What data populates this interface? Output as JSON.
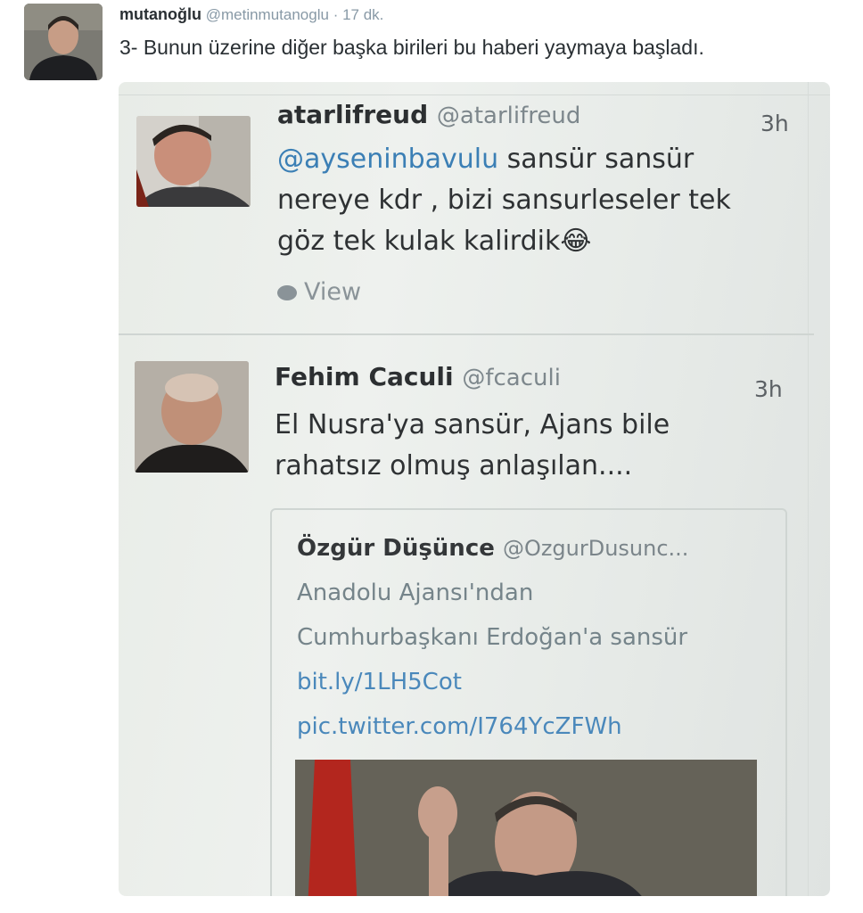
{
  "tweet": {
    "display_name": "mutanoğlu",
    "handle": "@metinmutanoglu",
    "separator": "·",
    "time": "17 dk.",
    "text": "3- Bunun üzerine diğer başka birileri bu haberi yaymaya başladı."
  },
  "photo": {
    "tweets": [
      {
        "name": "atarlifreud",
        "handle": "@atarlifreud",
        "time": "3h",
        "mention": "@ayseninbavulu",
        "line1_rest": " sansür sansür",
        "line2": "nereye kdr , bizi sansurleseler tek",
        "line3": "göz tek kulak kalirdik😂",
        "action_label": "View"
      },
      {
        "name": "Fehim Caculi",
        "handle": "@fcaculi",
        "time": "3h",
        "line1": "El Nusra'ya sansür, Ajans bile",
        "line2": "rahatsız olmuş anlaşılan....",
        "quote": {
          "name": "Özgür Düşünce",
          "handle": "@OzgurDusunc...",
          "line1": "Anadolu Ajansı'ndan",
          "line2": "Cumhurbaşkanı Erdoğan'a sansür",
          "link1": "bit.ly/1LH5Cot",
          "link2": "pic.twitter.com/I764YcZFWh"
        }
      }
    ]
  }
}
